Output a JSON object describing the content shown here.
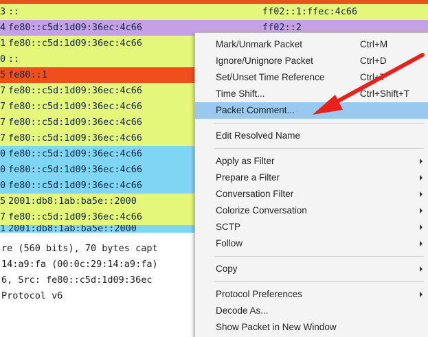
{
  "packet_rows": [
    {
      "idx": "3",
      "src": "::",
      "dst": "ff02::1:ffec:4c66",
      "bg": "#e4f77a"
    },
    {
      "idx": "4",
      "src": "fe80::c5d:1d09:36ec:4c66",
      "dst": "ff02::2",
      "bg": "#c6a0e6"
    },
    {
      "idx": "1",
      "src": "fe80::c5d:1d09:36ec:4c66",
      "dst": "",
      "bg": "#e4f77a"
    },
    {
      "idx": "0",
      "src": "::",
      "dst": "",
      "bg": "#e4f77a"
    },
    {
      "idx": "5",
      "src": "fe80::1",
      "dst": "",
      "bg": "#f04f1c"
    },
    {
      "idx": "7",
      "src": "fe80::c5d:1d09:36ec:4c66",
      "dst": "",
      "bg": "#e4f77a"
    },
    {
      "idx": "7",
      "src": "fe80::c5d:1d09:36ec:4c66",
      "dst": "",
      "bg": "#e4f77a"
    },
    {
      "idx": "7",
      "src": "fe80::c5d:1d09:36ec:4c66",
      "dst": "",
      "bg": "#e4f77a"
    },
    {
      "idx": "7",
      "src": "fe80::c5d:1d09:36ec:4c66",
      "dst": "",
      "bg": "#e4f77a"
    },
    {
      "idx": "0",
      "src": "fe80::c5d:1d09:36ec:4c66",
      "dst": "",
      "bg": "#7fd6f4"
    },
    {
      "idx": "0",
      "src": "fe80::c5d:1d09:36ec:4c66",
      "dst": "",
      "bg": "#7fd6f4"
    },
    {
      "idx": "0",
      "src": "fe80::c5d:1d09:36ec:4c66",
      "dst": "",
      "bg": "#7fd6f4"
    },
    {
      "idx": "5",
      "src": "2001:db8:1ab:ba5e::2000",
      "dst": "",
      "bg": "#e4f77a"
    },
    {
      "idx": "7",
      "src": "fe80::c5d:1d09:36ec:4c66",
      "dst": "",
      "bg": "#e4f77a"
    },
    {
      "idx": "1",
      "src": "2001:db8:1ab:ba5e::2000",
      "dst": "",
      "bg": "#7fd6f4"
    }
  ],
  "details": [
    "re (560 bits), 70 bytes capt",
    "14:a9:fa (00:0c:29:14:a9:fa)",
    " 6, Src: fe80::c5d:1d09:36ec",
    "Protocol v6"
  ],
  "menu": {
    "mark_unmark": {
      "label": "Mark/Unmark Packet",
      "shortcut": "Ctrl+M"
    },
    "ignore_unignore": {
      "label": "Ignore/Unignore Packet",
      "shortcut": "Ctrl+D"
    },
    "set_time_ref": {
      "label": "Set/Unset Time Reference",
      "shortcut": "Ctrl+T"
    },
    "time_shift": {
      "label": "Time Shift...",
      "shortcut": "Ctrl+Shift+T"
    },
    "packet_comment": {
      "label": "Packet Comment..."
    },
    "edit_resolved_name": {
      "label": "Edit Resolved Name"
    },
    "apply_as_filter": {
      "label": "Apply as Filter"
    },
    "prepare_a_filter": {
      "label": "Prepare a Filter"
    },
    "conversation_filter": {
      "label": "Conversation Filter"
    },
    "colorize_conversation": {
      "label": "Colorize Conversation"
    },
    "sctp": {
      "label": "SCTP"
    },
    "follow": {
      "label": "Follow"
    },
    "copy": {
      "label": "Copy"
    },
    "protocol_preferences": {
      "label": "Protocol Preferences"
    },
    "decode_as": {
      "label": "Decode As..."
    },
    "show_packet_new_window": {
      "label": "Show Packet in New Window"
    }
  },
  "colors": {
    "highlight": "#99c9f1",
    "arrow": "#e8211b",
    "top_strip": "#e8541e"
  },
  "icons": {
    "submenu_arrow": "submenu-arrow-icon",
    "annotation_arrow": "red-arrow-icon"
  }
}
